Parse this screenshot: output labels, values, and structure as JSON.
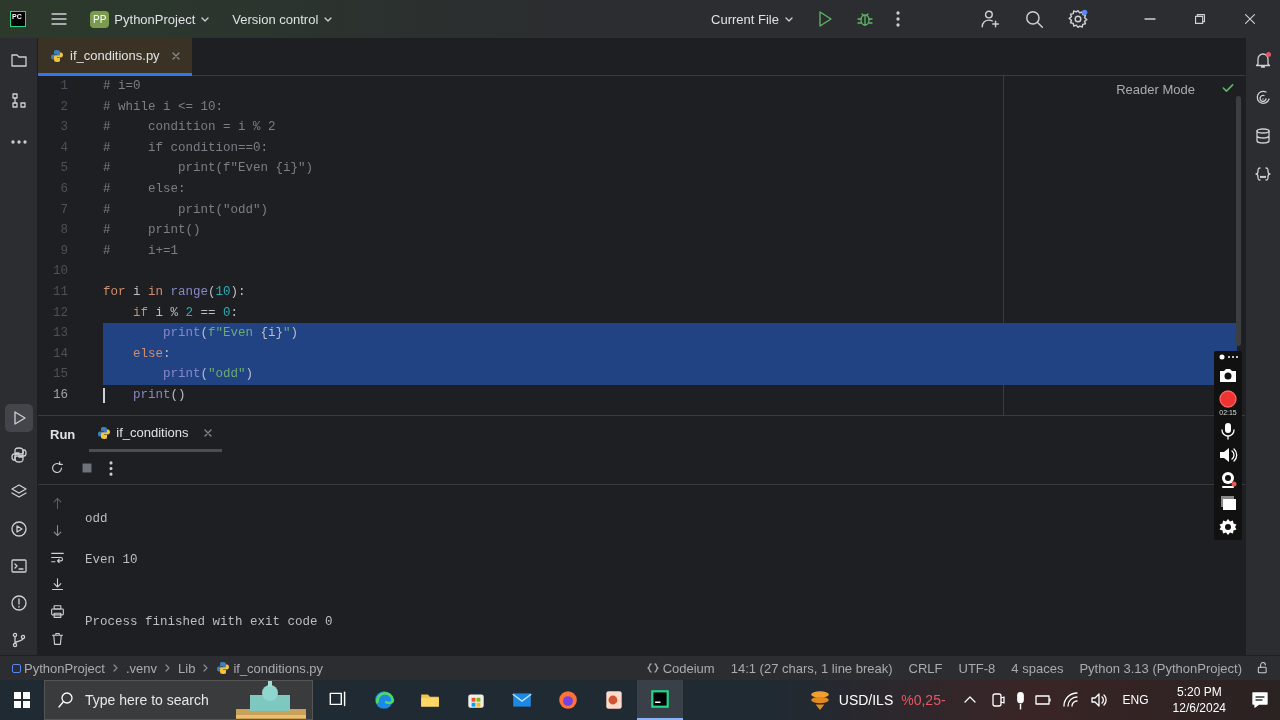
{
  "title_bar": {
    "logo": "PC",
    "project_badge": "PP",
    "project": "PythonProject",
    "vcs": "Version control",
    "run_config": "Current File"
  },
  "editor_tabs": [
    {
      "label": "if_conditions.py",
      "selected": true
    }
  ],
  "reader_mode": "Reader Mode",
  "code_lines": [
    {
      "number": "1",
      "selected": false,
      "current": false,
      "tokens": [
        {
          "text": "# i=0",
          "kind": "comment"
        }
      ]
    },
    {
      "number": "2",
      "selected": false,
      "current": false,
      "tokens": [
        {
          "text": "# while i <= 10:",
          "kind": "comment"
        }
      ]
    },
    {
      "number": "3",
      "selected": false,
      "current": false,
      "tokens": [
        {
          "text": "#     condition = i % 2",
          "kind": "comment"
        }
      ]
    },
    {
      "number": "4",
      "selected": false,
      "current": false,
      "tokens": [
        {
          "text": "#     if condition==0:",
          "kind": "comment"
        }
      ]
    },
    {
      "number": "5",
      "selected": false,
      "current": false,
      "tokens": [
        {
          "text": "#         print(f\"Even {i}\")",
          "kind": "comment"
        }
      ]
    },
    {
      "number": "6",
      "selected": false,
      "current": false,
      "tokens": [
        {
          "text": "#     else:",
          "kind": "comment"
        }
      ]
    },
    {
      "number": "7",
      "selected": false,
      "current": false,
      "tokens": [
        {
          "text": "#         print(\"odd\")",
          "kind": "comment"
        }
      ]
    },
    {
      "number": "8",
      "selected": false,
      "current": false,
      "tokens": [
        {
          "text": "#     print()",
          "kind": "comment"
        }
      ]
    },
    {
      "number": "9",
      "selected": false,
      "current": false,
      "tokens": [
        {
          "text": "#     i+=1",
          "kind": "comment"
        }
      ]
    },
    {
      "number": "10",
      "selected": false,
      "current": false
    },
    {
      "number": "11",
      "selected": false,
      "current": false,
      "tokens": [
        {
          "text": "for",
          "kind": "keyword"
        },
        {
          "text": " i ",
          "kind": "plain"
        },
        {
          "text": "in",
          "kind": "keyword"
        },
        {
          "text": " range",
          "kind": "builtin"
        },
        {
          "text": "(",
          "kind": "plain"
        },
        {
          "text": "10",
          "kind": "number"
        },
        {
          "text": "):",
          "kind": "plain"
        }
      ]
    },
    {
      "number": "12",
      "selected": false,
      "current": false,
      "tokens": [
        {
          "text": "    if",
          "kind": "keyword"
        },
        {
          "text": " i % ",
          "kind": "plain"
        },
        {
          "text": "2",
          "kind": "number"
        },
        {
          "text": " == ",
          "kind": "plain"
        },
        {
          "text": "0",
          "kind": "number"
        },
        {
          "text": ":",
          "kind": "plain"
        }
      ]
    },
    {
      "number": "13",
      "selected": true,
      "current": false,
      "tokens": [
        {
          "text": "        print",
          "kind": "builtin"
        },
        {
          "text": "(",
          "kind": "plain"
        },
        {
          "text": "f\"Even ",
          "kind": "string"
        },
        {
          "text": "{i}",
          "kind": "plain"
        },
        {
          "text": "\"",
          "kind": "string"
        },
        {
          "text": ")",
          "kind": "plain"
        }
      ]
    },
    {
      "number": "14",
      "selected": true,
      "current": false,
      "tokens": [
        {
          "text": "    else",
          "kind": "keyword"
        },
        {
          "text": ":",
          "kind": "plain"
        }
      ]
    },
    {
      "number": "15",
      "selected": true,
      "current": false,
      "tokens": [
        {
          "text": "        print",
          "kind": "builtin"
        },
        {
          "text": "(",
          "kind": "plain"
        },
        {
          "text": "\"odd\"",
          "kind": "string"
        },
        {
          "text": ")",
          "kind": "plain"
        }
      ]
    },
    {
      "number": "16",
      "selected": false,
      "current": true,
      "tokens": [
        {
          "text": "    print",
          "kind": "builtin"
        },
        {
          "text": "()",
          "kind": "plain"
        }
      ]
    }
  ],
  "run_panel": {
    "title": "Run",
    "tabs": [
      {
        "label": "if_conditions",
        "selected": true
      }
    ],
    "output": [
      {
        "kind": "text",
        "text": "odd"
      },
      {
        "kind": "blank"
      },
      {
        "kind": "text",
        "text": "Even 10"
      },
      {
        "kind": "blank"
      },
      {
        "kind": "blank"
      },
      {
        "kind": "text",
        "text": "Process finished with exit code 0"
      }
    ]
  },
  "status_bar": {
    "breadcrumbs": [
      "PythonProject",
      ".venv",
      "Lib",
      "if_conditions.py"
    ],
    "items": [
      "Codeium",
      "14:1 (27 chars, 1 line break)",
      "CRLF",
      "UTF-8",
      "4 spaces",
      "Python 3.13 (PythonProject)"
    ]
  },
  "recorder": {
    "recording": true,
    "timer": "02:15"
  },
  "taskbar": {
    "search_placeholder": "Type here to search",
    "ticker": "USD/ILS",
    "ticker_change": "%0,25-",
    "language": "ENG",
    "time": "5:20 PM",
    "date": "12/6/2024"
  }
}
